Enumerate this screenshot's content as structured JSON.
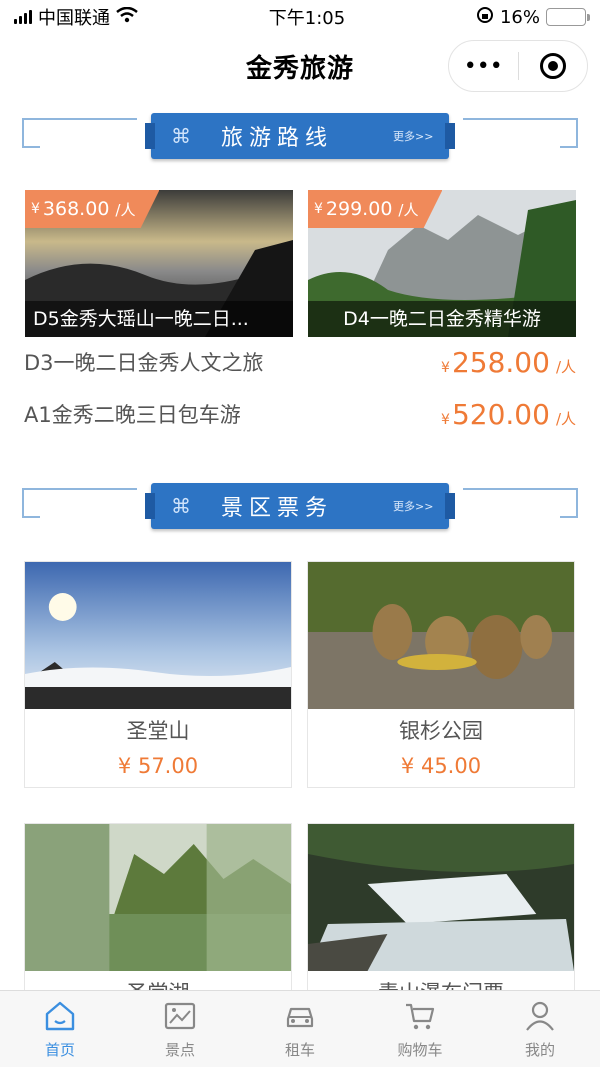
{
  "status_bar": {
    "carrier": "中国联通",
    "time": "下午1:05",
    "battery": "16%",
    "battery_level": 0.16
  },
  "header": {
    "title": "金秀旅游",
    "more_icon": "•••"
  },
  "sections": {
    "routes": {
      "title": "旅游路线",
      "more": "更多>>"
    },
    "tickets": {
      "title": "景区票务",
      "more": "更多>>"
    }
  },
  "route_cards": [
    {
      "currency": "¥",
      "price": "368.00",
      "unit": "/人",
      "name": "D5金秀大瑶山一晚二日..."
    },
    {
      "currency": "¥",
      "price": "299.00",
      "unit": "/人",
      "name": "D4一晚二日金秀精华游"
    }
  ],
  "route_list": [
    {
      "name": "D3一晚二日金秀人文之旅",
      "currency": "¥",
      "price": "258.00",
      "unit": "/人"
    },
    {
      "name": "A1金秀二晚三日包车游",
      "currency": "¥",
      "price": "520.00",
      "unit": "/人"
    }
  ],
  "spots": [
    {
      "name": "圣堂山",
      "price": "¥  57.00"
    },
    {
      "name": "银杉公园",
      "price": "¥  45.00"
    },
    {
      "name": "圣堂湖",
      "price": ""
    },
    {
      "name": "青山瀑布门票",
      "price": ""
    }
  ],
  "tabs": [
    {
      "label": "首页",
      "icon": "home-icon",
      "active": true
    },
    {
      "label": "景点",
      "icon": "scenic-icon",
      "active": false
    },
    {
      "label": "租车",
      "icon": "car-icon",
      "active": false
    },
    {
      "label": "购物车",
      "icon": "cart-icon",
      "active": false
    },
    {
      "label": "我的",
      "icon": "user-icon",
      "active": false
    }
  ],
  "colors": {
    "accent": "#3b8fe0",
    "price": "#ef7a36",
    "banner": "#2d74c4"
  }
}
